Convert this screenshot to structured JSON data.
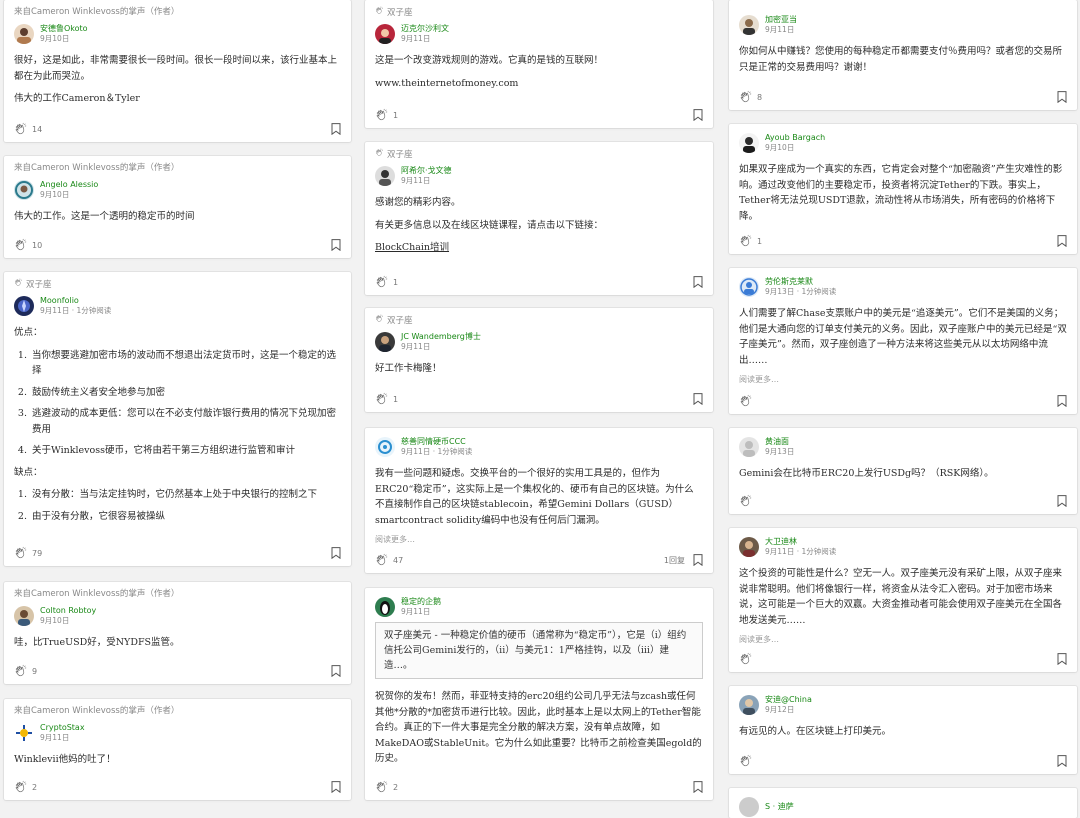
{
  "col1": {
    "c1": {
      "ctx": "来自Cameron Winklevoss的掌声（作者）",
      "name": "安德鲁Okoto",
      "date": "9月10日",
      "p1": "很好，这是如此，非常需要很长一段时间。很长一段时间以来，该行业基本上都在为此而哭泣。",
      "p2": "伟大的工作Cameron＆Tyler",
      "claps": "14"
    },
    "c2": {
      "ctx": "来自Cameron Winklevoss的掌声（作者）",
      "name": "Angelo Alessio",
      "date": "9月10日",
      "p1": "伟大的工作。这是一个透明的稳定币的时间",
      "claps": "10"
    },
    "c3": {
      "ctx": "双子座",
      "name": "Moonfolio",
      "date": "9月11日 · 1分钟阅读",
      "pros": "优点：",
      "li1": "当你想要逃避加密市场的波动而不想退出法定货币时，这是一个稳定的选择",
      "li2": "鼓励传统主义者安全地参与加密",
      "li3": "逃避波动的成本更低：您可以在不必支付敲诈银行费用的情况下兑现加密费用",
      "li4": "关于Winklevoss硬币，它将由若干第三方组织进行监管和审计",
      "cons": "缺点：",
      "li5": "没有分散：当与法定挂钩时，它仍然基本上处于中央银行的控制之下",
      "li6": "由于没有分散，它很容易被操纵",
      "claps": "79"
    },
    "c4": {
      "ctx": "来自Cameron Winklevoss的掌声（作者）",
      "name": "Colton Robtoy",
      "date": "9月10日",
      "p1": "哇，比TrueUSD好，受NYDFS监管。",
      "claps": "9"
    },
    "c5": {
      "ctx": "来自Cameron Winklevoss的掌声（作者）",
      "name": "CryptoStax",
      "date": "9月11日",
      "p1": "Winklevii他妈的吐了！",
      "claps": "2"
    }
  },
  "col2": {
    "c1": {
      "ctx": "双子座",
      "name": "迈克尔沙利文",
      "date": "9月11日",
      "p1": "这是一个改变游戏规则的游戏。它真的是钱的互联网！",
      "p2": "www.theinternetofmoney.com",
      "claps": "1"
    },
    "c2": {
      "ctx": "双子座",
      "name": "阿希尔·戈文德",
      "date": "9月11日",
      "p1": "感谢您的精彩内容。",
      "p2": "有关更多信息以及在线区块链课程，请点击以下链接：",
      "link": "BlockChain培训",
      "claps": "1"
    },
    "c3": {
      "ctx": "双子座",
      "name": "JC Wandemberg博士",
      "date": "9月11日",
      "p1": "好工作卡梅隆！",
      "claps": "1"
    },
    "c4": {
      "name": "慈善同情硬币CCC",
      "date": "9月11日 · 1分钟阅读",
      "p1": "我有一些问题和疑虑。交换平台的一个很好的实用工具是的，但作为ERC20“稳定币”，这实际上是一个集权化的、硬币有自己的区块链。为什么不直接制作自己的区块链stablecoin，希望Gemini Dollars（GUSD）smartcontract solidity编码中也没有任何后门漏洞。",
      "more": "阅读更多…",
      "claps": "47",
      "replies": "1回复"
    },
    "c5": {
      "name": "稳定的企鹅",
      "date": "9月11日",
      "quote": "双子座美元 - 一种稳定价值的硬币（通常称为“稳定币”），它是（i）组约信托公司Gemini发行的，（ii）与美元1：1严格挂钩，以及（iii）建造…。",
      "p1": "祝贺你的发布！然而，菲亚特支持的erc20组约公司几乎无法与zcash或任何其他*分散的*加密货币进行比较。因此，此时基本上是以太网上的Tether智能合约。真正的下一件大事是完全分散的解决方案，没有单点故障，如MakeDAO或StableUnit。它为什么如此重要？比特币之前检查美国egold的历史。",
      "claps": "2"
    }
  },
  "col3": {
    "c1": {
      "name": "加密亚当",
      "date": "9月11日",
      "p1": "你如何从中赚钱？您使用的每种稳定币都需要支付％费用吗？或者您的交易所只是正常的交易费用吗？谢谢！",
      "claps": "8"
    },
    "c2": {
      "name": "Ayoub Bargach",
      "date": "9月10日",
      "p1": "如果双子座成为一个真实的东西，它肯定会对整个“加密融资”产生灾难性的影响。通过改变他们的主要稳定币，投资者将沉淀Tether的下跌。事实上，Tether将无法兑现USDT退款，流动性将从市场消失，所有密码的价格将下降。",
      "claps": "1"
    },
    "c3": {
      "name": "劳伦斯克莱默",
      "date": "9月13日 · 1分钟阅读",
      "p1": "人们需要了解Chase支票账户中的美元是“追逐美元”。它们不是美国的义务；他们是大通向您的订单支付美元的义务。因此，双子座账户中的美元已经是“双子座美元”。然而，双子座创造了一种方法来将这些美元从以太坊网络中流出……",
      "more": "阅读更多…",
      "claps": ""
    },
    "c4": {
      "name": "黄油面",
      "date": "9月13日",
      "p1": "Gemini会在比特币ERC20上发行USDg吗？（RSK网络）。",
      "claps": ""
    },
    "c5": {
      "name": "大卫迪林",
      "date": "9月11日 · 1分钟阅读",
      "p1": "这个投资的可能性是什么？空无一人。双子座美元没有采矿上限，从双子座来说非常聪明。他们将像银行一样，将资金从法令汇入密码。对于加密市场来说，这可能是一个巨大的双赢。大资金推动者可能会使用双子座美元在全国各地发送美元……",
      "more": "阅读更多…",
      "claps": ""
    },
    "c6": {
      "name": "安迪@China",
      "date": "9月12日",
      "p1": "有远见的人。在区块链上打印美元。",
      "claps": ""
    },
    "c7": {
      "name": "S · 迪萨",
      "date": ""
    }
  },
  "icons": {
    "clap": "clap-icon",
    "bookmark": "bookmark-icon"
  },
  "colors": {
    "green_name": "#1a8917",
    "background": "#f2f2f2"
  }
}
